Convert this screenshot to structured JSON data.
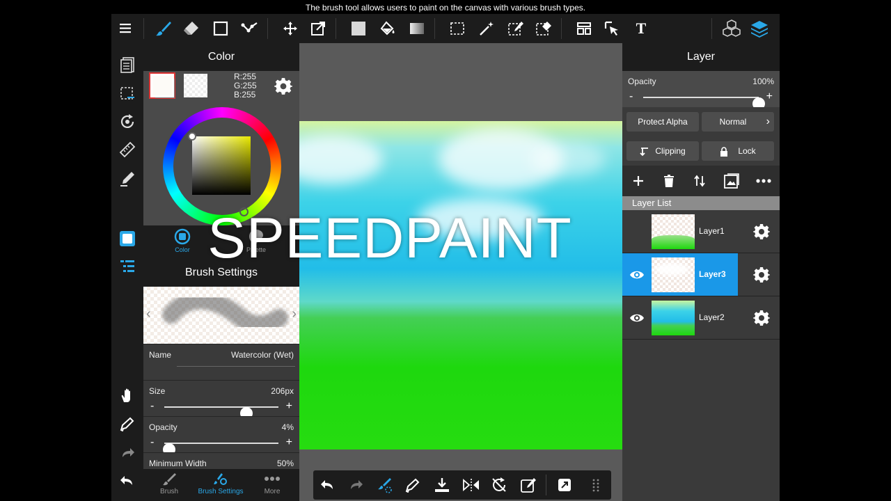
{
  "caption": "The brush tool allows users to paint on the canvas with various brush types.",
  "overlay_text": "SPEEDPAINT",
  "toolbar": {
    "icons": [
      "menu-icon",
      "brush-icon",
      "eraser-icon",
      "rectangle-icon",
      "dot-line-icon",
      "move-icon",
      "transform-icon",
      "fill-color-icon",
      "bucket-icon",
      "gradient-icon",
      "select-icon",
      "magic-wand-icon",
      "select-pen-icon",
      "select-eraser-icon",
      "panel-icon",
      "select-arrow-icon",
      "text-icon",
      "materials-icon",
      "layers-icon"
    ],
    "text_tool_label": "T"
  },
  "color_panel": {
    "title": "Color",
    "r": "R:255",
    "g": "G:255",
    "b": "B:255",
    "tabs": {
      "color": "Color",
      "palette": "Palette"
    }
  },
  "brush_settings": {
    "title": "Brush Settings",
    "name_label": "Name",
    "name_value": "Watercolor (Wet)",
    "size_label": "Size",
    "size_value": "206px",
    "size_level": 0.72,
    "opacity_label": "Opacity",
    "opacity_value": "4%",
    "opacity_level": 0.04,
    "min_width_label": "Minimum Width",
    "min_width_value": "50%",
    "minus": "-",
    "plus": "+"
  },
  "bottom_tabs": [
    {
      "label": "Brush"
    },
    {
      "label": "Brush Settings"
    },
    {
      "label": "More"
    }
  ],
  "layer_panel": {
    "title": "Layer",
    "opacity_label": "Opacity",
    "opacity_value": "100%",
    "opacity_level": 1.0,
    "protect_alpha": "Protect Alpha",
    "blend_mode": "Normal",
    "clipping": "Clipping",
    "lock": "Lock",
    "list_title": "Layer List",
    "layers": [
      {
        "name": "Layer1",
        "visible": true,
        "selected": false
      },
      {
        "name": "Layer3",
        "visible": true,
        "selected": true
      },
      {
        "name": "Layer2",
        "visible": true,
        "selected": false
      }
    ]
  },
  "colors": {
    "accent": "#2aa8e8",
    "selected_layer": "#1a98e8",
    "panel_dark": "#1c1c1c"
  }
}
